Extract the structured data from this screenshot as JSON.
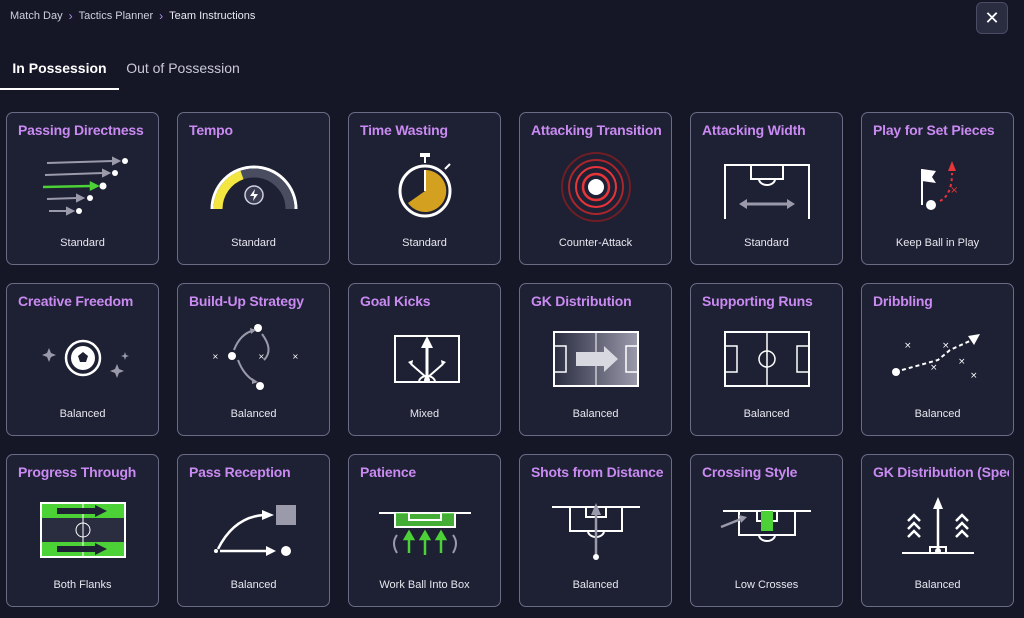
{
  "breadcrumb": {
    "items": [
      "Match Day",
      "Tactics Planner",
      "Team Instructions"
    ]
  },
  "close_label": "✕",
  "tabs": [
    {
      "label": "In Possession",
      "active": true
    },
    {
      "label": "Out of Possession",
      "active": false
    }
  ],
  "colors": {
    "background": "#161726",
    "card_bg": "#1e2033",
    "card_border": "#6a6c86",
    "title": "#c98af2",
    "accent_green": "#4cd137",
    "accent_yellow": "#f4e640",
    "accent_red": "#e8353a"
  },
  "cards": [
    {
      "title": "Passing Directness",
      "value": "Standard",
      "icon": "passing-arrows-icon"
    },
    {
      "title": "Tempo",
      "value": "Standard",
      "icon": "tempo-gauge-icon"
    },
    {
      "title": "Time Wasting",
      "value": "Standard",
      "icon": "stopwatch-icon"
    },
    {
      "title": "Attacking Transition",
      "value": "Counter-Attack",
      "icon": "radar-rings-icon"
    },
    {
      "title": "Attacking Width",
      "value": "Standard",
      "icon": "pitch-width-icon"
    },
    {
      "title": "Play for Set Pieces",
      "value": "Keep Ball in Play",
      "icon": "corner-flag-icon"
    },
    {
      "title": "Creative Freedom",
      "value": "Balanced",
      "icon": "ball-sparkle-icon"
    },
    {
      "title": "Build-Up Strategy",
      "value": "Balanced",
      "icon": "build-up-icon"
    },
    {
      "title": "Goal Kicks",
      "value": "Mixed",
      "icon": "goal-kick-icon"
    },
    {
      "title": "GK Distribution",
      "value": "Balanced",
      "icon": "pitch-arrow-icon"
    },
    {
      "title": "Supporting Runs",
      "value": "Balanced",
      "icon": "pitch-icon"
    },
    {
      "title": "Dribbling",
      "value": "Balanced",
      "icon": "dribble-path-icon"
    },
    {
      "title": "Progress Through",
      "value": "Both Flanks",
      "icon": "flanks-pitch-icon"
    },
    {
      "title": "Pass Reception",
      "value": "Balanced",
      "icon": "pass-reception-icon"
    },
    {
      "title": "Patience",
      "value": "Work Ball Into Box",
      "icon": "patience-box-icon"
    },
    {
      "title": "Shots from Distance",
      "value": "Balanced",
      "icon": "shot-distance-icon"
    },
    {
      "title": "Crossing Style",
      "value": "Low Crosses",
      "icon": "crossing-icon"
    },
    {
      "title": "GK Distribution (Speed)",
      "value": "Balanced",
      "icon": "gk-speed-icon"
    }
  ]
}
